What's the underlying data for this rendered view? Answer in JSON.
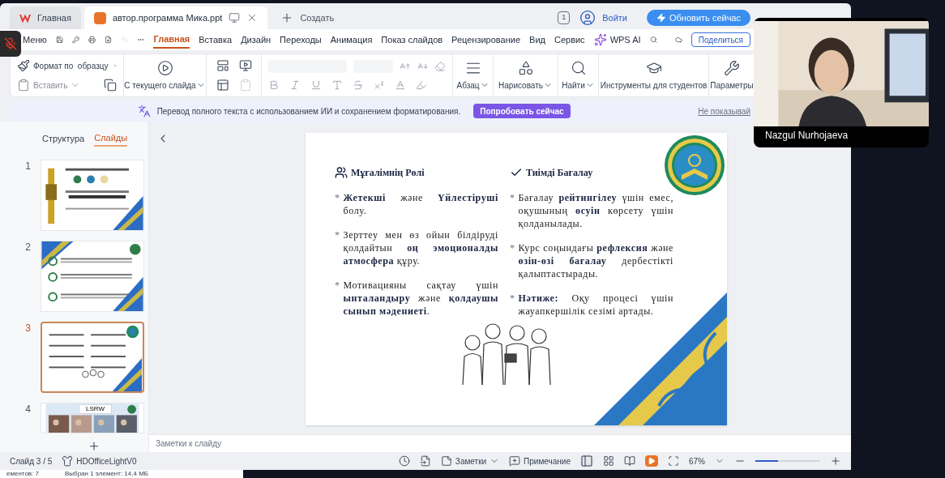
{
  "tabs": [
    {
      "label": "Главная",
      "kind": "home",
      "selected": false
    },
    {
      "label": "автор.программа Мика.ppt",
      "kind": "document",
      "selected": true
    }
  ],
  "new_tab": "Создать",
  "account": {
    "badge": "1",
    "login": "Войти",
    "upgrade": "Обновить сейчас"
  },
  "menu": {
    "label": "Меню",
    "tabs": [
      {
        "label": "Главная",
        "selected": true
      },
      {
        "label": "Вставка",
        "selected": false
      },
      {
        "label": "Дизайн",
        "selected": false
      },
      {
        "label": "Переходы",
        "selected": false
      },
      {
        "label": "Анимация",
        "selected": false
      },
      {
        "label": "Показ слайдов",
        "selected": false
      },
      {
        "label": "Рецензирование",
        "selected": false
      },
      {
        "label": "Вид",
        "selected": false
      },
      {
        "label": "Сервис",
        "selected": false
      }
    ],
    "ai": "WPS AI",
    "share": "Поделиться"
  },
  "ribbon": {
    "format_painter": "Формат по  образцу",
    "paste": {
      "label": "Вставить",
      "disabled": true
    },
    "slideshow": "С текущего слайда",
    "paragraph": "Абзац",
    "draw": "Нарисовать",
    "find": "Найти",
    "student_tools": "Инструменты для студентов",
    "settings": "Параметры"
  },
  "banner": {
    "text": "Перевод полного текста с использованием ИИ и сохранением форматирования.",
    "button": "Попробовать сейчас",
    "dismiss": "Не показывай"
  },
  "panel": {
    "tabs": [
      {
        "label": "Структура",
        "selected": false
      },
      {
        "label": "Слайды",
        "selected": true
      }
    ],
    "slides": [
      {
        "number": "1",
        "kind": "title",
        "selected": false
      },
      {
        "number": "2",
        "kind": "checklist",
        "selected": false
      },
      {
        "number": "3",
        "kind": "columns",
        "selected": true
      },
      {
        "number": "4",
        "kind": "photos",
        "label": "LSRW",
        "selected": false
      }
    ]
  },
  "slide": {
    "columns": [
      {
        "heading": "Мұғалімнің Рөлі",
        "paragraphs": [
          {
            "bullet": "*",
            "text": "**Жетекші** және **Үйлестіруші** болу."
          },
          {
            "bullet": "*",
            "text": "Зерттеу мен өз ойын білдіруді қолдайтын **оң эмоционалды атмосфера** құру."
          },
          {
            "bullet": "*",
            "text": "Мотивацияны сақтау үшін **ынталандыру** және **қолдаушы сынып мәдениеті**."
          }
        ]
      },
      {
        "heading": "Тиімді Бағалау",
        "paragraphs": [
          {
            "bullet": "*",
            "text": "Бағалау **рейтингілеу** үшін емес, оқушының **өсуін** көрсету үшін қолданылады."
          },
          {
            "bullet": "*",
            "text": "Курс соңындағы **рефлексия** және **өзін-өзі бағалау** дербестікті қалыптастырады."
          },
          {
            "bullet": "*",
            "text": "**Нәтиже:** Оқу процесі үшін жауапкершілік сезімі артады."
          }
        ]
      }
    ]
  },
  "notes_placeholder": "Заметки к слайду",
  "status": {
    "slide": "Слайд 3 / 5",
    "theme": "HDOfficeLightV0",
    "notes": "Заметки",
    "comment": "Примечание",
    "zoom": {
      "value": "67%",
      "level": 0.35
    }
  },
  "video": {
    "name": "Nazgul Nurhojaeva",
    "muted": true
  },
  "explorer": [
    "ементов: 7",
    "Выбран 1 элемент: 14,4 МБ"
  ]
}
